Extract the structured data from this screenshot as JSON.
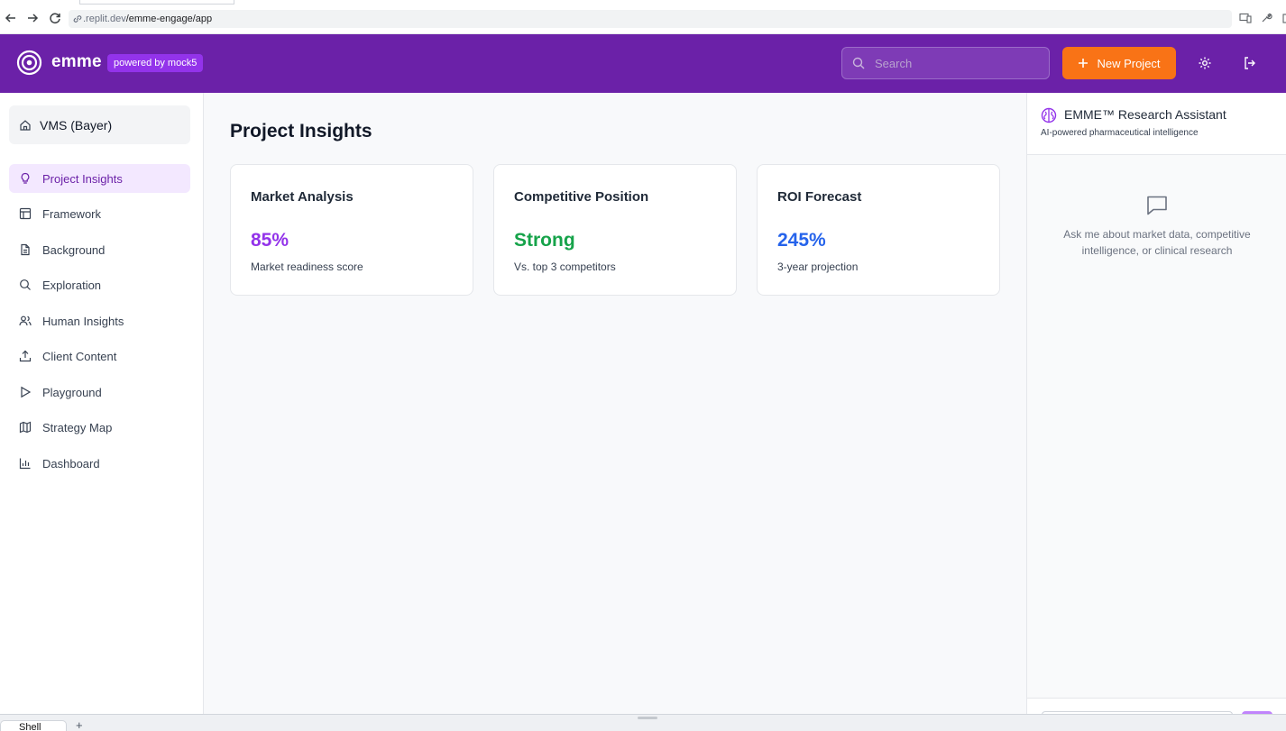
{
  "browser": {
    "url_prefix": ".replit.dev",
    "url_path": "/emme-engage/app"
  },
  "header": {
    "brand": "emme",
    "badge": "powered by mock5",
    "search_placeholder": "Search",
    "new_project_label": "New Project",
    "accent_color": "#6b21a8",
    "button_color": "#f97316"
  },
  "sidebar": {
    "project": "VMS (Bayer)",
    "items": [
      {
        "label": "Project Insights",
        "icon": "lightbulb-icon",
        "active": true
      },
      {
        "label": "Framework",
        "icon": "layout-icon"
      },
      {
        "label": "Background",
        "icon": "document-icon"
      },
      {
        "label": "Exploration",
        "icon": "search-icon"
      },
      {
        "label": "Human Insights",
        "icon": "users-icon"
      },
      {
        "label": "Client Content",
        "icon": "upload-icon"
      },
      {
        "label": "Playground",
        "icon": "play-icon"
      },
      {
        "label": "Strategy Map",
        "icon": "map-icon"
      },
      {
        "label": "Dashboard",
        "icon": "bar-chart-icon"
      }
    ]
  },
  "main": {
    "title": "Project Insights",
    "cards": [
      {
        "title": "Market Analysis",
        "value": "85%",
        "sub": "Market readiness score",
        "color": "#9333ea"
      },
      {
        "title": "Competitive Position",
        "value": "Strong",
        "sub": "Vs. top 3 competitors",
        "color": "#16a34a"
      },
      {
        "title": "ROI Forecast",
        "value": "245%",
        "sub": "3-year projection",
        "color": "#2563eb"
      }
    ]
  },
  "assistant": {
    "title": "EMME™ Research Assistant",
    "subtitle": "AI-powered pharmaceutical intelligence",
    "empty_text": "Ask me about market data, competitive intelligence, or clinical research"
  },
  "bottom": {
    "shell_tab": "Shell",
    "plus": "+"
  }
}
